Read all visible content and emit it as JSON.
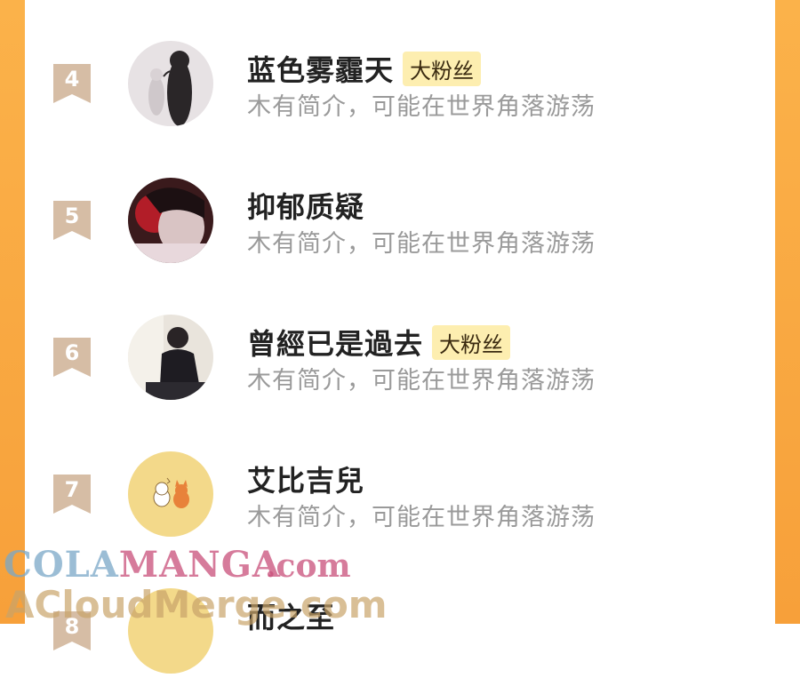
{
  "colors": {
    "frame": "#f8a83e",
    "badge": "#d6bda5",
    "fan_tag_bg": "#fdeeb0",
    "name": "#222222",
    "bio": "#9a9a9a"
  },
  "entries": [
    {
      "rank": "4",
      "name": "蓝色雾霾天",
      "tag": "大粉丝",
      "bio": "木有简介，可能在世界角落游荡",
      "avatar": "avatar-ghost-figure"
    },
    {
      "rank": "5",
      "name": "抑郁质疑",
      "tag": "",
      "bio": "木有简介，可能在世界角落游荡",
      "avatar": "avatar-red-light-face"
    },
    {
      "rank": "6",
      "name": "曾經已是過去",
      "tag": "大粉丝",
      "bio": "木有简介，可能在世界角落游荡",
      "avatar": "avatar-sitting-person"
    },
    {
      "rank": "7",
      "name": "艾比吉兒",
      "tag": "",
      "bio": "木有简介，可能在世界角落游荡",
      "avatar": "avatar-cartoon-fox"
    },
    {
      "rank": "8",
      "name": "而之至",
      "tag": "",
      "bio": "",
      "avatar": "avatar-yellow"
    }
  ],
  "watermark": {
    "line1_a": "COLA",
    "line1_b": "MANGA",
    "line1_c": ".com",
    "line2": "ACloudMerge.com"
  }
}
